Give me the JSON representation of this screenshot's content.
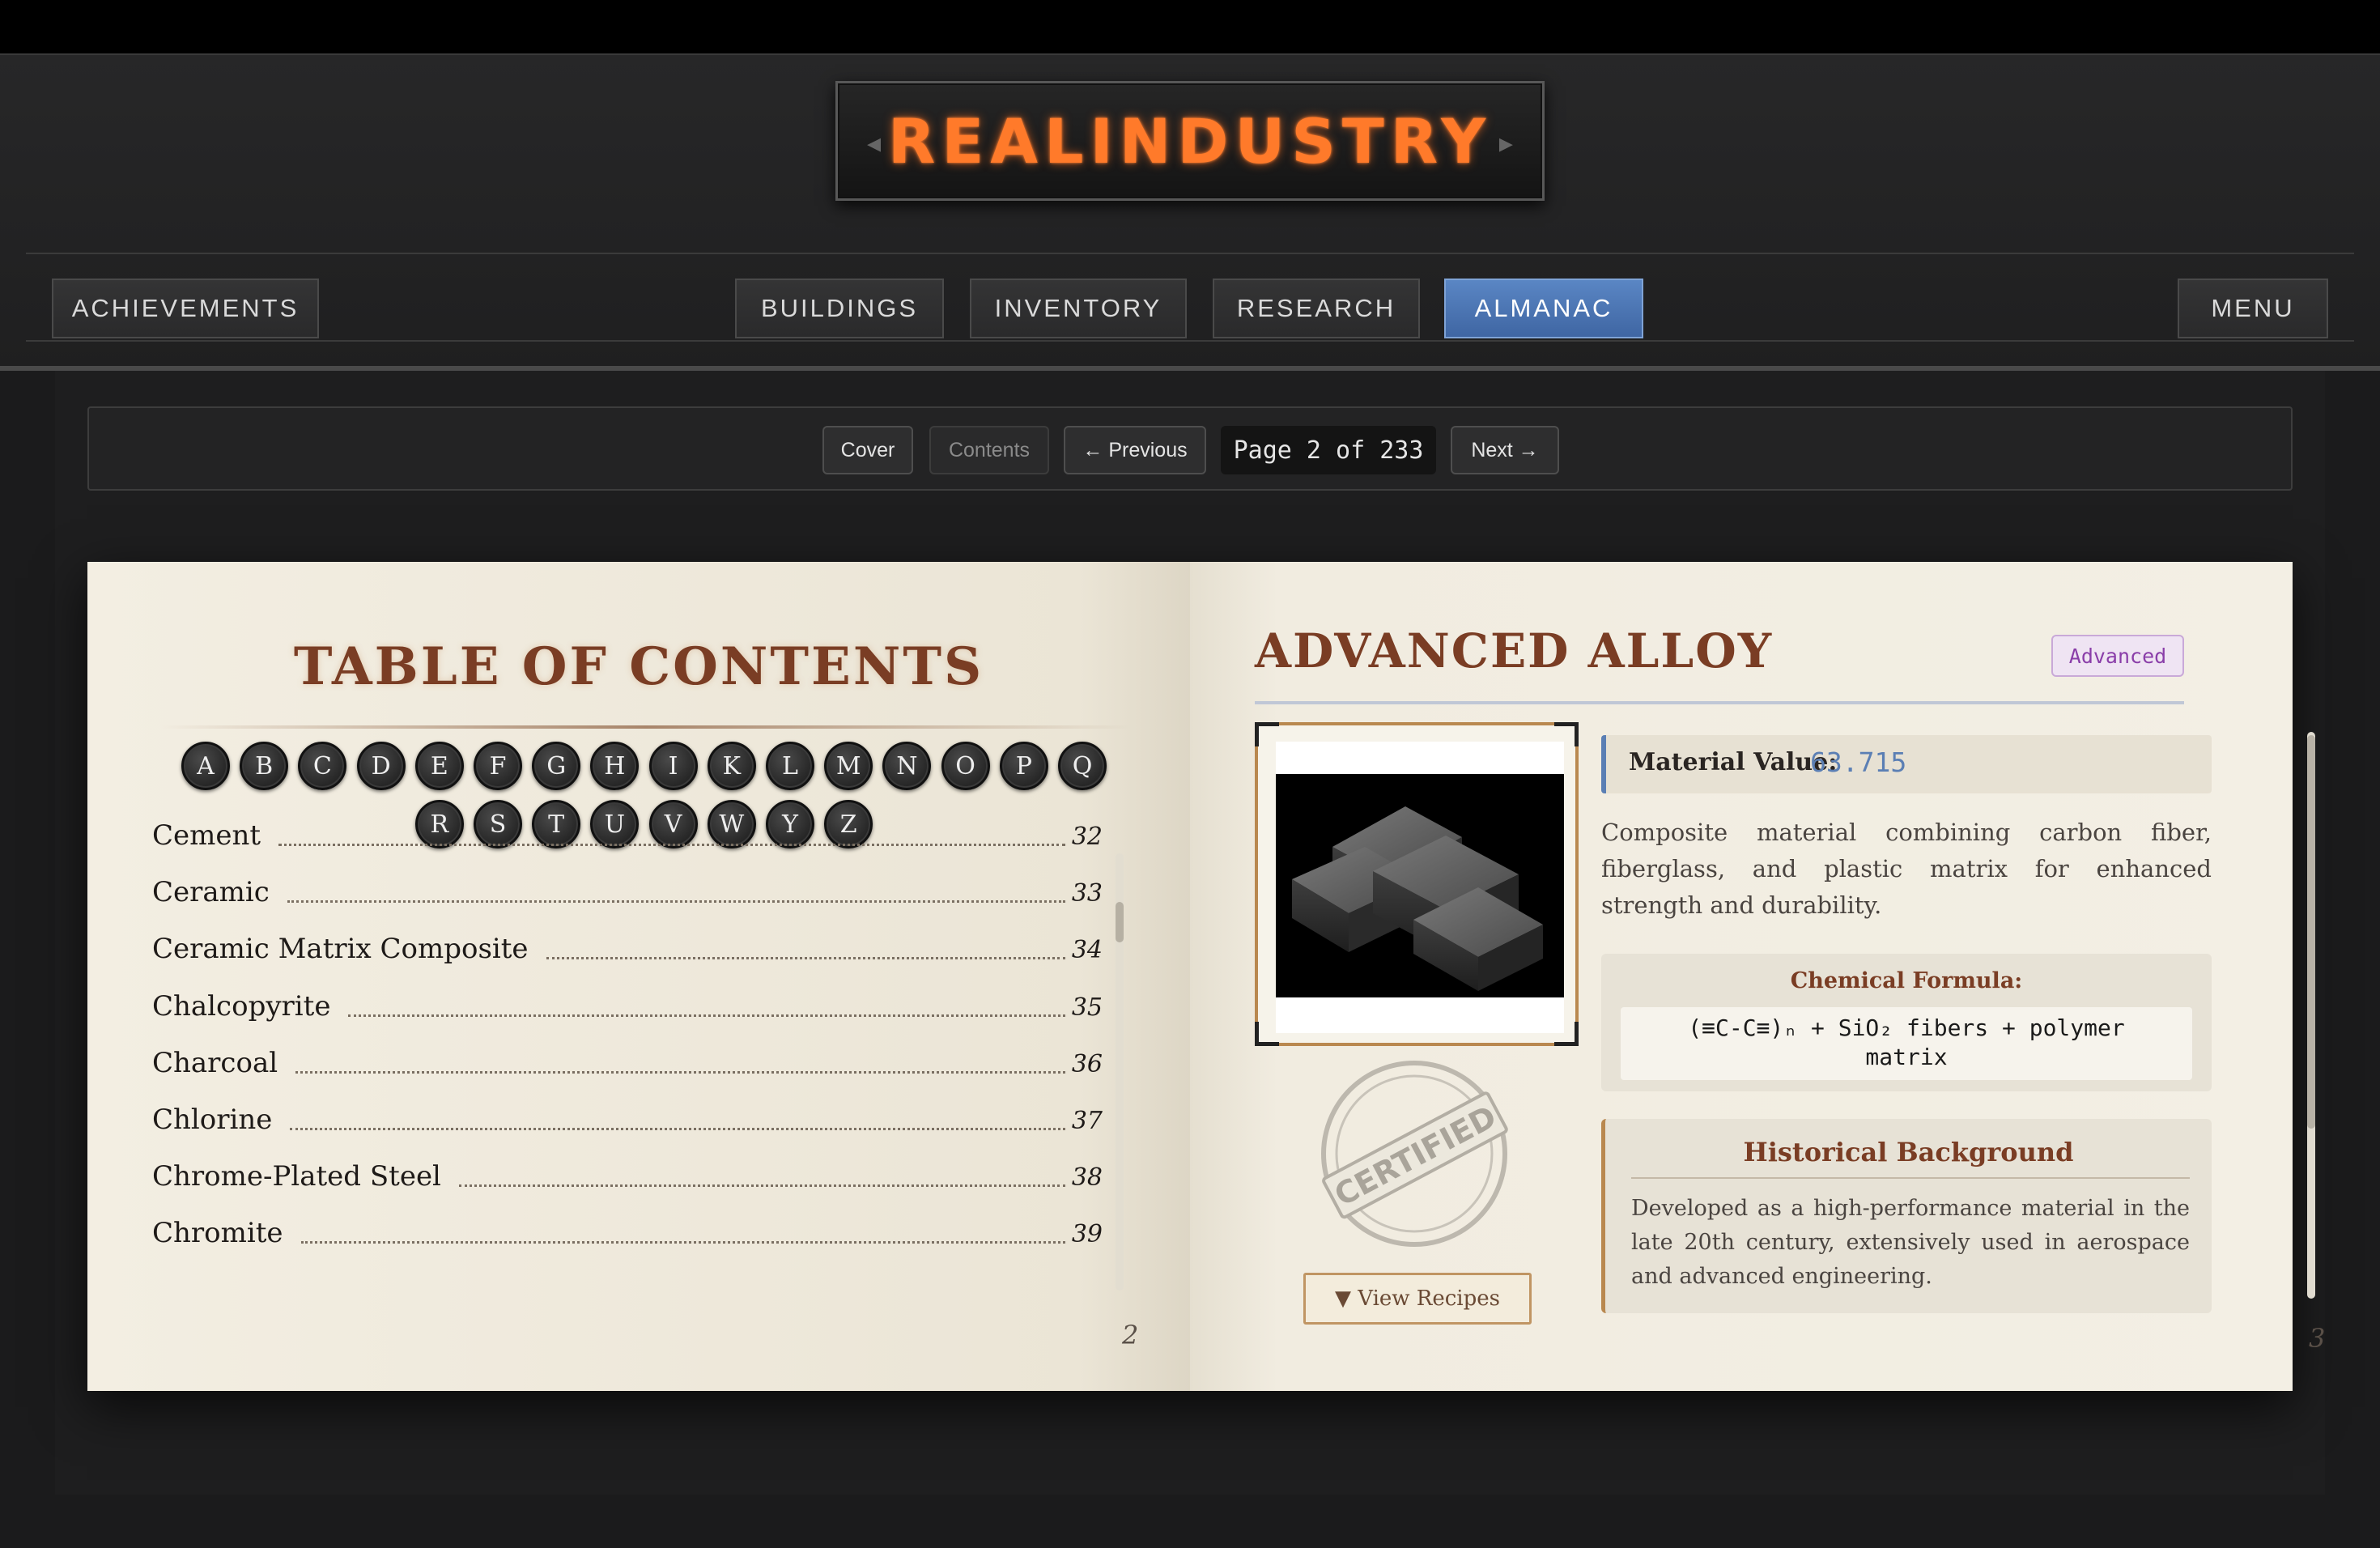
{
  "app": {
    "logo": "REALINDUSTRY"
  },
  "nav": {
    "achievements": "ACHIEVEMENTS",
    "buildings": "BUILDINGS",
    "inventory": "INVENTORY",
    "research": "RESEARCH",
    "almanac": "ALMANAC",
    "menu": "MENU",
    "active": "ALMANAC",
    "active_color": "#4a72b0"
  },
  "toolbar": {
    "cover": "Cover",
    "contents": "Contents",
    "previous": "← Previous",
    "page_label": "Page 2 of 233",
    "next": "Next →"
  },
  "toc": {
    "title": "TABLE OF CONTENTS",
    "letters": [
      "A",
      "B",
      "C",
      "D",
      "E",
      "F",
      "G",
      "H",
      "I",
      "K",
      "L",
      "M",
      "N",
      "O",
      "P",
      "Q",
      "R",
      "S",
      "T",
      "U",
      "V",
      "W",
      "Y",
      "Z"
    ],
    "entries": [
      {
        "name": "Cement",
        "page": "32"
      },
      {
        "name": "Ceramic",
        "page": "33"
      },
      {
        "name": "Ceramic Matrix Composite",
        "page": "34"
      },
      {
        "name": "Chalcopyrite",
        "page": "35"
      },
      {
        "name": "Charcoal",
        "page": "36"
      },
      {
        "name": "Chlorine",
        "page": "37"
      },
      {
        "name": "Chrome-Plated Steel",
        "page": "38"
      },
      {
        "name": "Chromite",
        "page": "39"
      }
    ],
    "page_number": "2"
  },
  "item": {
    "title": "ADVANCED ALLOY",
    "tier": "Advanced",
    "tier_color": "#8a3ea9",
    "value_label": "Material Value:",
    "value": "63.715",
    "description": "Composite material combining carbon fiber, fiberglass, and plastic matrix for enhanced strength and durability.",
    "formula_label": "Chemical Formula:",
    "formula": "(≡C-C≡)ₙ + SiO₂ fibers + polymer matrix",
    "stamp_text": "CERTIFIED",
    "recipes_button": "▼ View Recipes",
    "history_title": "Historical Background",
    "history_text": "Developed as a high-performance material in the late 20th century, extensively used in aerospace and advanced engineering.",
    "page_number": "3"
  }
}
